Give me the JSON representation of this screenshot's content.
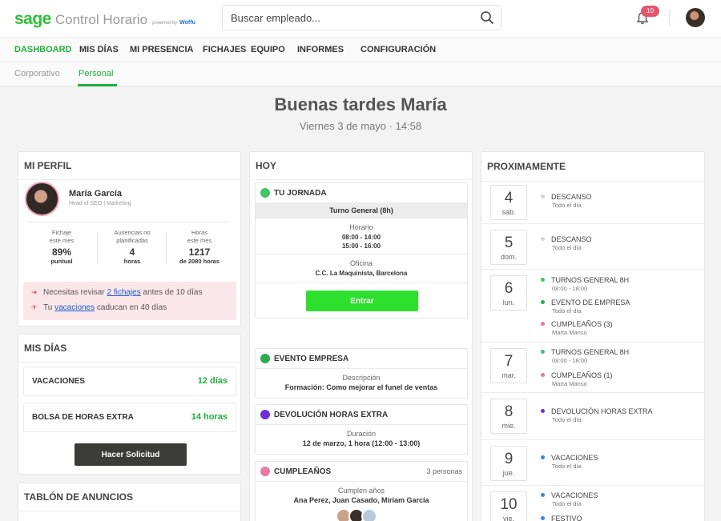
{
  "header": {
    "logo_brand": "sage",
    "logo_app": "Control Horario",
    "powered_by": "powered by",
    "powered_brand": "Woffu",
    "search_placeholder": "Buscar empleado...",
    "notifications_count": "10"
  },
  "menu": {
    "items": [
      "DASHBOARD",
      "MIS DÍAS",
      "MI PRESENCIA",
      "FICHAJES",
      "EQUIPO",
      "INFORMES",
      "CONFIGURACIÓN"
    ],
    "active": "DASHBOARD"
  },
  "submenu": {
    "items": [
      "Corporativo",
      "Personal"
    ],
    "active": "Personal"
  },
  "greeting": {
    "title": "Buenas tardes María",
    "subtitle": "Viernes 3 de mayo · 14:58"
  },
  "perfil": {
    "title": "MI PERFIL",
    "name": "María García",
    "role": "Head of SEO | Marketing",
    "stats": [
      {
        "label_1": "Fichaje",
        "label_2": "este mes",
        "value": "89%",
        "unit": "puntual"
      },
      {
        "label_1": "Ausencias no",
        "label_2": "planificadas",
        "value": "4",
        "unit": "horas"
      },
      {
        "label_1": "Horas",
        "label_2": "este mes",
        "value": "1217",
        "unit": "de 2080 horas"
      }
    ],
    "alert_1_pre": "Necesitas revisar",
    "alert_1_link": "2 fichajes",
    "alert_1_post": "antes de 10 días",
    "alert_2_pre": "Tu",
    "alert_2_link": "vacaciones",
    "alert_2_post": "caducan en 40 días"
  },
  "mis_dias": {
    "title": "MIS DÍAS",
    "rows": [
      {
        "label": "VACACIONES",
        "value": "12 días"
      },
      {
        "label": "BOLSA DE HORAS EXTRA",
        "value": "14 horas"
      }
    ],
    "button": "Hacer Solicitud"
  },
  "tablon": {
    "title": "TABLÓN DE ANUNCIOS"
  },
  "hoy": {
    "title": "HOY",
    "jornada": {
      "title": "TU JORNADA",
      "turno": "Turno General (8h)",
      "horario_label": "Horario",
      "horario_1": "08:00 - 14:00",
      "horario_2": "15:00 - 16:00",
      "oficina_label": "Oficina",
      "oficina": "C.C. La Maquinista, Barcelona",
      "button": "Entrar"
    },
    "evento": {
      "title": "EVENTO EMPRESA",
      "label": "Descripción",
      "value": "Formación: Como mejorar el funel de ventas"
    },
    "devolucion": {
      "title": "DEVOLUCIÓN HORAS EXTRA",
      "label": "Duración",
      "value": "12 de marzo, 1 hora (12:00 - 13:00)"
    },
    "cumple": {
      "title": "CUMPLEAÑOS",
      "count": "3 personas",
      "label": "Cumplen años",
      "value": "Ana Perez, Juan Casado, Miriam García"
    }
  },
  "proximamente": {
    "title": "PROXIMAMENTE",
    "days": [
      {
        "day": "4",
        "dow": "sab.",
        "events": [
          {
            "title": "DESCANSO",
            "sub": "Todo el día",
            "color": "#d6d6d6"
          }
        ]
      },
      {
        "day": "5",
        "dow": "dom.",
        "events": [
          {
            "title": "DESCANSO",
            "sub": "Todo el día",
            "color": "#d6d6d6"
          }
        ]
      },
      {
        "day": "6",
        "dow": "lun.",
        "events": [
          {
            "title": "TURNOS GENERAL 8H",
            "sub": "08:00 - 18:00",
            "color": "#41c463"
          },
          {
            "title": "EVENTO DE EMPRESA",
            "sub": "Todo el día",
            "color": "#2eaa4e"
          },
          {
            "title": "CUMPLEAÑOS (3)",
            "sub": "Marta Manso",
            "color": "#e57ba6"
          }
        ]
      },
      {
        "day": "7",
        "dow": "mar.",
        "events": [
          {
            "title": "TURNOS GENERAL 8H",
            "sub": "08:00 - 18:00",
            "color": "#41c463"
          },
          {
            "title": "CUMPLEAÑOS (1)",
            "sub": "Marta Manso",
            "color": "#e57ba6"
          }
        ]
      },
      {
        "day": "8",
        "dow": "mie.",
        "events": [
          {
            "title": "DEVOLUCIÓN HORAS EXTRA",
            "sub": "Todo el día",
            "color": "#6d2fd6"
          }
        ]
      },
      {
        "day": "9",
        "dow": "jue.",
        "events": [
          {
            "title": "VACACIONES",
            "sub": "Todo el día",
            "color": "#3b82e6"
          }
        ]
      },
      {
        "day": "10",
        "dow": "vie.",
        "events": [
          {
            "title": "VACACIONES",
            "sub": "Todo el día",
            "color": "#3b82e6"
          },
          {
            "title": "FESTIVO",
            "sub": "",
            "color": "#3b82e6"
          }
        ]
      }
    ]
  },
  "colors": {
    "brand_green": "#2fbf3a",
    "active_green": "#1fb03c",
    "button_green": "#2ee02e",
    "alert_bg": "#fbe7ea",
    "badge_red": "#e4566a",
    "link_blue": "#1a5ec8"
  }
}
